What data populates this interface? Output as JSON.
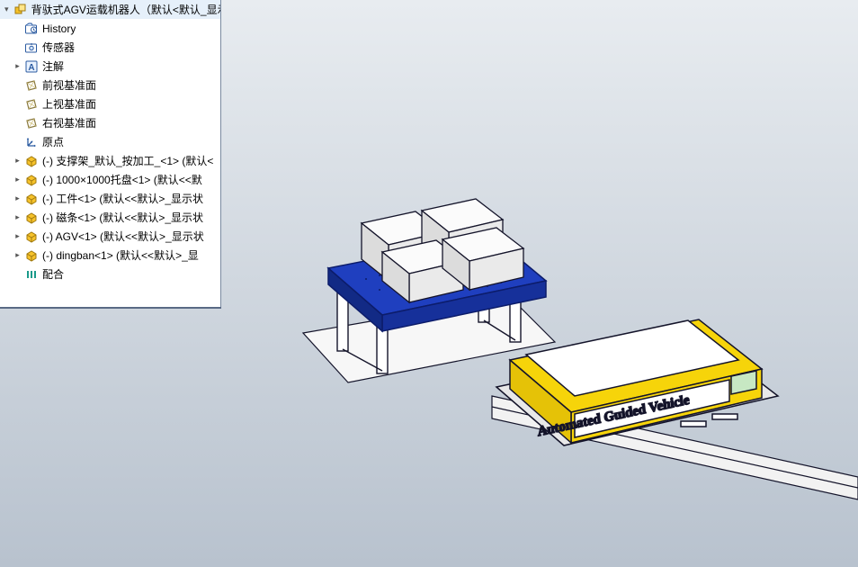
{
  "root": {
    "label": "背驮式AGV运载机器人（默认<默认_显示"
  },
  "tree": [
    {
      "expander": "blank",
      "icon": "folder-history-icon",
      "label": "History"
    },
    {
      "expander": "blank",
      "icon": "folder-sensor-icon",
      "label": "传感器"
    },
    {
      "expander": "right",
      "icon": "annotation-icon",
      "label": "注解"
    },
    {
      "expander": "blank",
      "icon": "plane-icon",
      "label": "前视基准面"
    },
    {
      "expander": "blank",
      "icon": "plane-icon",
      "label": "上视基准面"
    },
    {
      "expander": "blank",
      "icon": "plane-icon",
      "label": "右视基准面"
    },
    {
      "expander": "blank",
      "icon": "origin-icon",
      "label": "原点"
    },
    {
      "expander": "right",
      "icon": "part-icon",
      "label": "(-) 支撑架_默认_按加工_<1> (默认<"
    },
    {
      "expander": "right",
      "icon": "part-icon",
      "label": "(-) 1000×1000托盘<1> (默认<<默"
    },
    {
      "expander": "right",
      "icon": "part-icon",
      "label": "(-) 工件<1> (默认<<默认>_显示状"
    },
    {
      "expander": "right",
      "icon": "part-icon",
      "label": "(-) 磁条<1> (默认<<默认>_显示状"
    },
    {
      "expander": "right",
      "icon": "part-icon",
      "label": "(-) AGV<1> (默认<<默认>_显示状"
    },
    {
      "expander": "right",
      "icon": "part-icon",
      "label": "(-) dingban<1> (默认<<默认>_显"
    },
    {
      "expander": "blank",
      "icon": "mates-icon",
      "label": "配合"
    }
  ],
  "scene": {
    "agv_text": "Automated Guided Vehicle",
    "colors": {
      "pallet": "#1f3fbf",
      "agv_body": "#f6d40a",
      "agv_top": "#ffffff",
      "box": "#f3f3f3",
      "floor": "#f7f7f7",
      "line": "#14142a",
      "screen": "#c7e8c3"
    }
  }
}
